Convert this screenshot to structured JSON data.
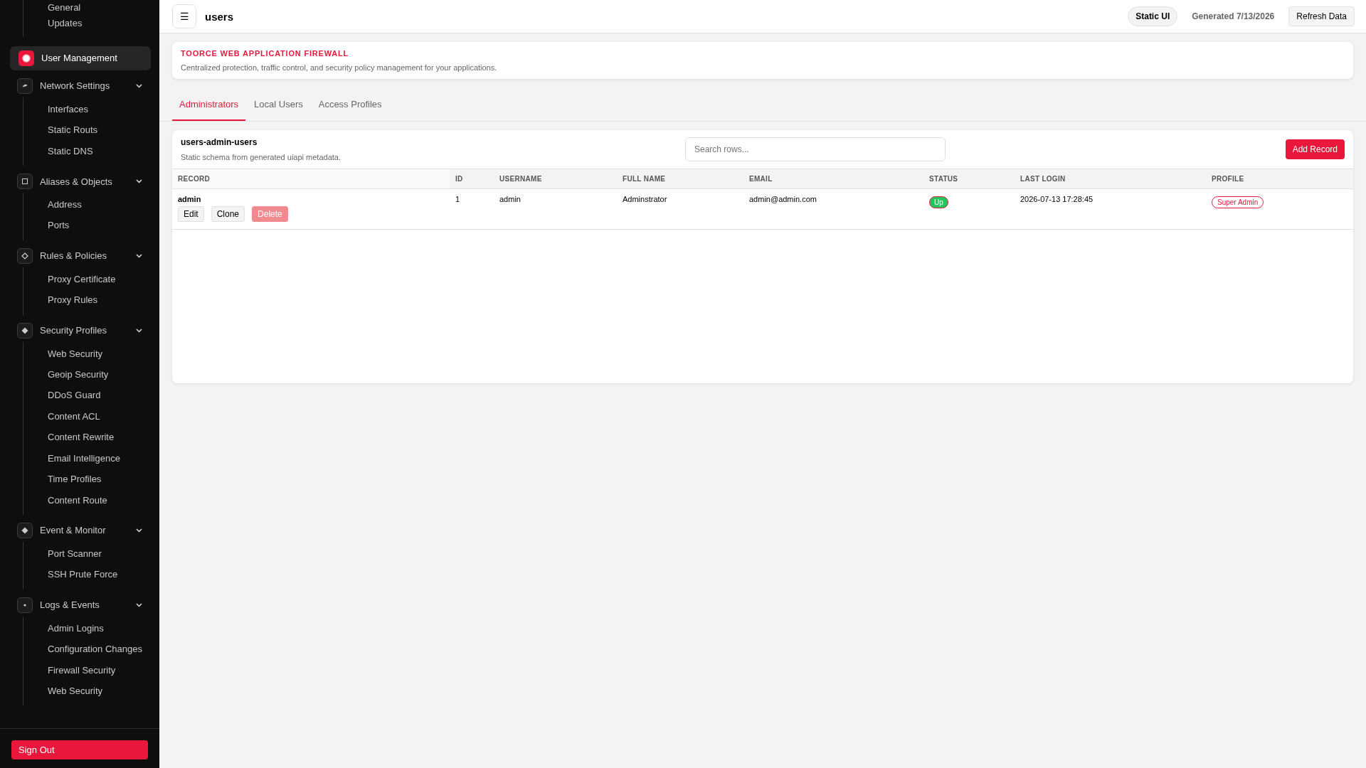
{
  "sidebar": {
    "top_items": [
      {
        "label": "General"
      },
      {
        "label": "Updates"
      }
    ],
    "active_item": {
      "label": "User Management",
      "selected": true
    },
    "groups": [
      {
        "label": "Network Settings",
        "expanded": true,
        "children": [
          {
            "label": "Interfaces"
          },
          {
            "label": "Static Routs"
          },
          {
            "label": "Static DNS"
          }
        ]
      },
      {
        "label": "Aliases & Objects",
        "expanded": true,
        "children": [
          {
            "label": "Address"
          },
          {
            "label": "Ports"
          }
        ]
      },
      {
        "label": "Rules & Policies",
        "expanded": true,
        "children": [
          {
            "label": "Proxy Certificate"
          },
          {
            "label": "Proxy Rules"
          }
        ]
      },
      {
        "label": "Security Profiles",
        "expanded": true,
        "children": [
          {
            "label": "Web Security"
          },
          {
            "label": "Geoip Security"
          },
          {
            "label": "DDoS Guard"
          },
          {
            "label": "Content ACL"
          },
          {
            "label": "Content Rewrite"
          },
          {
            "label": "Email Intelligence"
          },
          {
            "label": "Time Profiles"
          },
          {
            "label": "Content Route"
          }
        ]
      },
      {
        "label": "Event & Monitor",
        "expanded": true,
        "children": [
          {
            "label": "Port Scanner"
          },
          {
            "label": "SSH Prute Force"
          }
        ]
      },
      {
        "label": "Logs & Events",
        "expanded": true,
        "children": [
          {
            "label": "Admin Logins"
          },
          {
            "label": "Configuration Changes"
          },
          {
            "label": "Firewall Security"
          },
          {
            "label": "Web Security"
          }
        ]
      }
    ],
    "sign_out": "Sign Out"
  },
  "topbar": {
    "menu_glyph": "☰",
    "title": "users",
    "mode_badge": "Static UI",
    "generated": "Generated 7/13/2026",
    "refresh_button": "Refresh Data"
  },
  "banner": {
    "title": "TOORCE WEB APPLICATION FIREWALL",
    "subtitle": "Centralized protection, traffic control, and security policy management for your applications."
  },
  "tabs": [
    {
      "label": "Administrators",
      "selected": true
    },
    {
      "label": "Local Users",
      "selected": false
    },
    {
      "label": "Access Profiles",
      "selected": false
    }
  ],
  "table": {
    "title": "users-admin-users",
    "subtitle": "Static schema from generated uiapi metadata.",
    "search": {
      "placeholder": "Search rows..."
    },
    "add_button": "Add Record",
    "columns": [
      "RECORD",
      "ID",
      "USERNAME",
      "FULL NAME",
      "EMAIL",
      "STATUS",
      "LAST LOGIN",
      "PROFILE"
    ],
    "rows": [
      {
        "record": "admin",
        "actions": [
          "Edit",
          "Clone",
          "Delete"
        ],
        "id": "1",
        "username": "admin",
        "full_name": "Adminstrator",
        "email": "admin@admin.com",
        "status": "Up",
        "last_login": "2026-07-13 17:28:45",
        "profile": "Super Admin"
      }
    ]
  }
}
